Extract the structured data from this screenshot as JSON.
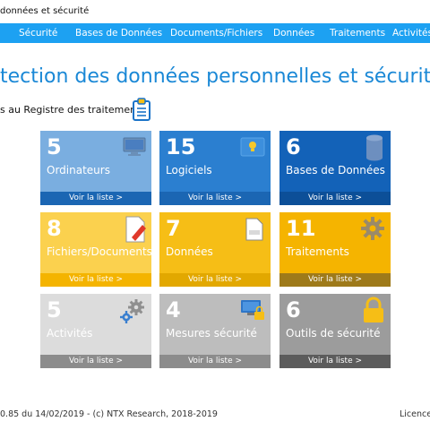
{
  "window": {
    "title": "données et sécurité"
  },
  "nav": {
    "items": [
      "Sécurité",
      "Bases de Données",
      "Documents/Fichiers",
      "Données",
      "Traitements",
      "Activités"
    ]
  },
  "page": {
    "title": "tection des données personnelles et sécurité",
    "register_link": "s au Registre des traitements"
  },
  "tiles": [
    {
      "count": "5",
      "label": "Ordinateurs",
      "link": "Voir la liste >",
      "icon": "monitor-icon"
    },
    {
      "count": "15",
      "label": "Logiciels",
      "link": "Voir la liste >",
      "icon": "lightbulb-window-icon"
    },
    {
      "count": "6",
      "label": "Bases de Données",
      "link": "Voir la liste >",
      "icon": "database-icon"
    },
    {
      "count": "8",
      "label": "Fichiers/Documents",
      "link": "Voir la liste >",
      "icon": "document-edit-icon"
    },
    {
      "count": "7",
      "label": "Données",
      "link": "Voir la liste >",
      "icon": "xml-file-icon"
    },
    {
      "count": "11",
      "label": "Traitements",
      "link": "Voir la liste >",
      "icon": "gear-icon"
    },
    {
      "count": "5",
      "label": "Activités",
      "link": "Voir la liste >",
      "icon": "gears-icon"
    },
    {
      "count": "4",
      "label": "Mesures sécurité",
      "link": "Voir la liste >",
      "icon": "monitor-lock-icon"
    },
    {
      "count": "6",
      "label": "Outils de sécurité",
      "link": "Voir la liste >",
      "icon": "padlock-icon"
    }
  ],
  "colors": {
    "nav": "#1da1f2",
    "title": "#1a88d6",
    "blue_tile": "#1a73c8",
    "yellow_tile": "#f6be16",
    "gray_tile": "#b9b9b9"
  },
  "footer": {
    "version": "0.85 du 14/02/2019 - (c) NTX Research, 2018-2019",
    "licence": "Licence"
  }
}
